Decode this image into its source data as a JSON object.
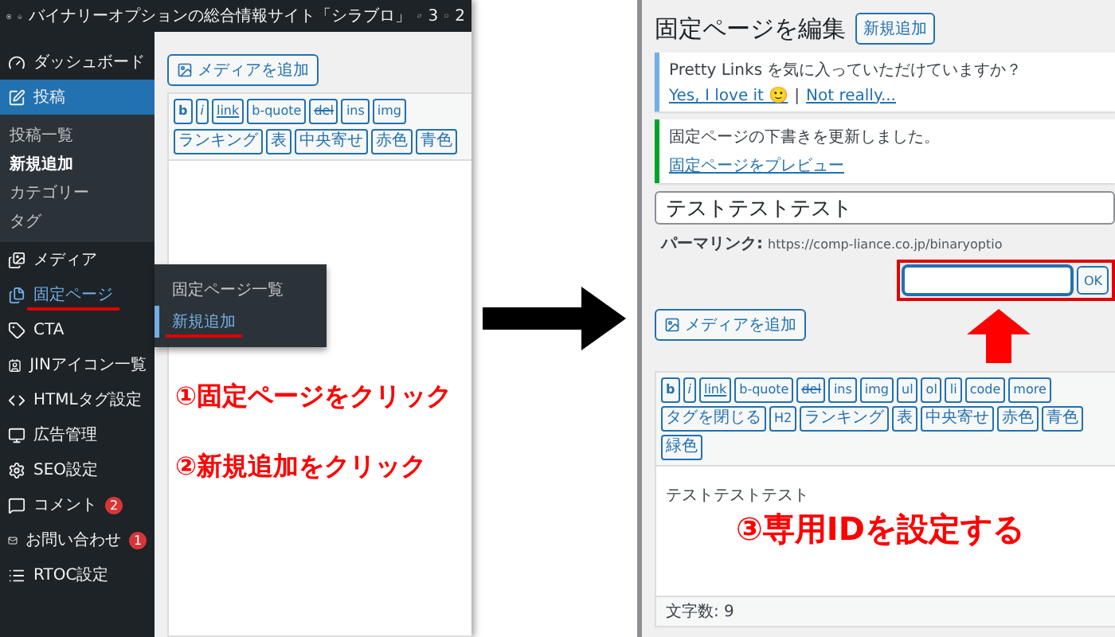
{
  "left_screenshot": {
    "admin_bar": {
      "site_title": "バイナリーオプションの総合情報サイト「シラブロ」",
      "updates": "3",
      "comments": "2"
    },
    "sidebar": [
      {
        "label": "ダッシュボード",
        "selected": false,
        "hovered": false,
        "underlined": false
      },
      {
        "label": "投稿",
        "selected": true,
        "hovered": false,
        "underlined": false,
        "children": [
          {
            "label": "投稿一覧",
            "selected": false
          },
          {
            "label": "新規追加",
            "selected": true
          },
          {
            "label": "カテゴリー",
            "selected": false
          },
          {
            "label": "タグ",
            "selected": false
          }
        ]
      },
      {
        "label": "メディア",
        "selected": false,
        "hovered": false,
        "underlined": false
      },
      {
        "label": "固定ページ",
        "selected": false,
        "hovered": true,
        "underlined": true,
        "flyout": [
          {
            "label": "固定ページ一覧",
            "selected": false,
            "underlined": false
          },
          {
            "label": "新規追加",
            "selected": true,
            "underlined": true
          }
        ]
      },
      {
        "label": "CTA",
        "selected": false,
        "hovered": false,
        "underlined": false
      },
      {
        "label": "JINアイコン一覧",
        "selected": false,
        "hovered": false,
        "underlined": false
      },
      {
        "label": "HTMLタグ設定",
        "selected": false,
        "hovered": false,
        "underlined": false
      },
      {
        "label": "広告管理",
        "selected": false,
        "hovered": false,
        "underlined": false
      },
      {
        "label": "SEO設定",
        "selected": false,
        "hovered": false,
        "underlined": false
      },
      {
        "label": "コメント",
        "selected": false,
        "hovered": false,
        "underlined": false,
        "badge": "2"
      },
      {
        "label": "お問い合わせ",
        "selected": false,
        "hovered": false,
        "underlined": false,
        "badge": "1"
      },
      {
        "label": "RTOC設定",
        "selected": false,
        "hovered": false,
        "underlined": false
      }
    ],
    "editor": {
      "media_button": "メディアを追加",
      "toolbar": [
        [
          {
            "label": "b",
            "kind": "bold"
          },
          {
            "label": "i",
            "kind": "italic"
          },
          {
            "label": "link",
            "kind": "link"
          },
          {
            "label": "b-quote",
            "kind": "plain"
          },
          {
            "label": "del",
            "kind": "strike"
          },
          {
            "label": "ins",
            "kind": "plain"
          },
          {
            "label": "img",
            "kind": "plain"
          }
        ],
        [
          {
            "label": "ランキング",
            "kind": "plain"
          },
          {
            "label": "表",
            "kind": "plain"
          },
          {
            "label": "中央寄せ",
            "kind": "plain"
          },
          {
            "label": "赤色",
            "kind": "plain"
          },
          {
            "label": "青色",
            "kind": "plain"
          }
        ]
      ]
    }
  },
  "right_screenshot": {
    "heading": "固定ページを編集",
    "add_new_button": "新規追加",
    "notices": [
      {
        "kind": "info",
        "message": "Pretty Links を気に入っていただけていますか？",
        "links": [
          "Yes, I love it 🙂",
          "Not really..."
        ],
        "separator": "|"
      },
      {
        "kind": "success",
        "message": "固定ページの下書きを更新しました。",
        "links": [
          "固定ページをプレビュー"
        ]
      }
    ],
    "title_field": "テストテストテスト",
    "permalink": {
      "label": "パーマリンク:",
      "url": "https://comp-liance.co.jp/binaryoptio",
      "ok_button": "OK"
    },
    "media_button": "メディアを追加",
    "toolbar": [
      {
        "label": "b",
        "kind": "bold"
      },
      {
        "label": "i",
        "kind": "italic"
      },
      {
        "label": "link",
        "kind": "link"
      },
      {
        "label": "b-quote",
        "kind": "plain"
      },
      {
        "label": "del",
        "kind": "strike"
      },
      {
        "label": "ins",
        "kind": "plain"
      },
      {
        "label": "img",
        "kind": "plain"
      },
      {
        "label": "ul",
        "kind": "plain"
      },
      {
        "label": "ol",
        "kind": "plain"
      },
      {
        "label": "li",
        "kind": "plain"
      },
      {
        "label": "code",
        "kind": "plain"
      },
      {
        "label": "more",
        "kind": "plain"
      },
      {
        "label": "タグを閉じる",
        "kind": "plain"
      },
      {
        "label": "H2",
        "kind": "plain"
      },
      {
        "label": "ランキング",
        "kind": "plain"
      },
      {
        "label": "表",
        "kind": "plain"
      },
      {
        "label": "中央寄せ",
        "kind": "plain"
      },
      {
        "label": "赤色",
        "kind": "plain"
      },
      {
        "label": "青色",
        "kind": "plain"
      },
      {
        "label": "緑色",
        "kind": "plain"
      }
    ],
    "editor_text": "テストテストテスト",
    "word_count": "文字数: 9"
  },
  "annotations": [
    "①固定ページをクリック",
    "②新規追加をクリック",
    "③専用IDを設定する"
  ]
}
